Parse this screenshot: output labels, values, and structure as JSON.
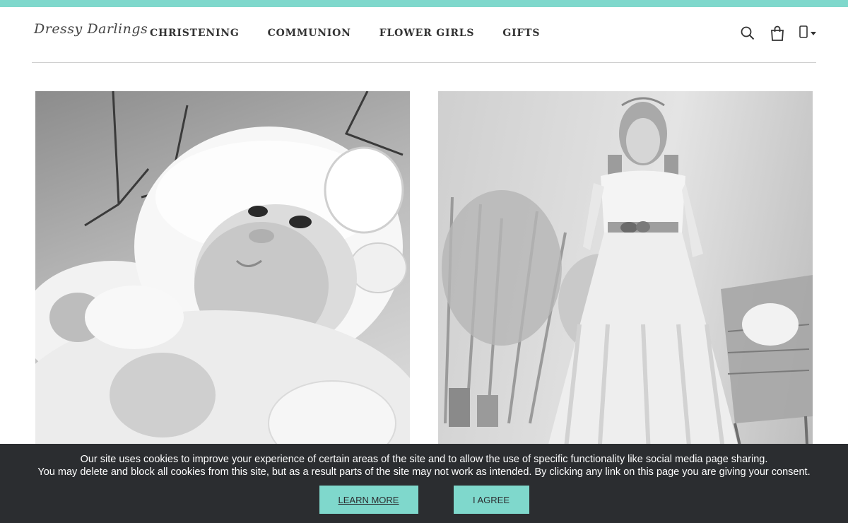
{
  "brand": {
    "logo_text": "Dressy Darlings",
    "accent_color": "#7fd8cc"
  },
  "nav": {
    "items": [
      {
        "label": "CHRISTENING"
      },
      {
        "label": "COMMUNION"
      },
      {
        "label": "FLOWER GIRLS"
      },
      {
        "label": "GIFTS"
      }
    ]
  },
  "header_icons": [
    "search-icon",
    "shopping-bag-icon",
    "phone-icon",
    "chevron-down-icon"
  ],
  "hero": {
    "left_image": "baby-christening-photo",
    "right_image": "girl-communion-dress-photo"
  },
  "cookie": {
    "line1": "Our site uses cookies to improve your experience of certain areas of the site and to allow the use of specific functionality like social media page sharing.",
    "line2": "You may delete and block all cookies from this site, but as a result parts of the site may not work as intended. By clicking any link on this page you are giving your consent.",
    "learn_more": "LEARN MORE",
    "agree": "I AGREE",
    "bar_color": "#2b2d30"
  }
}
